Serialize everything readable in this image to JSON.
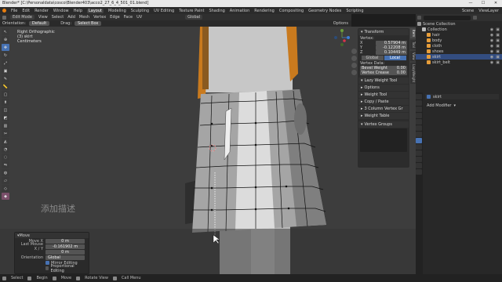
{
  "titlebar": {
    "title": "Blender* [C:\\Personaldata\\cosco\\Blender403\\acco2_27_6_4_501_01.blend]",
    "buttons": [
      "—",
      "☐",
      "✕"
    ]
  },
  "menubar": {
    "menus": [
      "File",
      "Edit",
      "Render",
      "Window",
      "Help"
    ],
    "workspaces": [
      "Layout",
      "Modeling",
      "Sculpting",
      "UV Editing",
      "Texture Paint",
      "Shading",
      "Animation",
      "Rendering",
      "Compositing",
      "Geometry Nodes",
      "Scripting"
    ],
    "active_workspace": "Layout",
    "scene": "Scene",
    "view_layer": "ViewLayer"
  },
  "header": {
    "mode": "Edit Mode",
    "menus": [
      "View",
      "Select",
      "Add",
      "Mesh",
      "Vertex",
      "Edge",
      "Face",
      "UV"
    ],
    "transform_orientation": "Global"
  },
  "tool_header": {
    "orientation_label": "Orientation:",
    "orientation_value": "Default",
    "drag_label": "Drag:",
    "drag_value": "Select Box",
    "options_label": "Options"
  },
  "viewport_info": {
    "line1": "Right Orthographic",
    "line2": "(3) skirt",
    "line3": "Centimeters"
  },
  "overlay_label": "添加描述",
  "npanel": {
    "transform_title": "Transform",
    "vertex_label": "Vertex:",
    "x_label": "X",
    "x_value": "0.57904 m",
    "y_label": "Y",
    "y_value": "-0.12208 m",
    "z_label": "Z",
    "z_value": "0.10449 m",
    "global_label": "Global",
    "local_label": "Local",
    "vertex_data_label": "Vertex Data:",
    "bevel_weight_label": "Bevel Weight",
    "bevel_weight_value": "0.00",
    "vertex_crease_label": "Vertex Crease",
    "vertex_crease_value": "0.00",
    "lazy_weight_title": "Lazy Weight Tool",
    "lazy_options": "Options",
    "weight_tool_label": "Weight Tool",
    "copy_paste_label": "Copy / Paste",
    "column_vertex_label": "3 Column Vertex Gr",
    "weight_table_label": "Weight Table",
    "vertex_groups_title": "Vertex Groups"
  },
  "vtabs": [
    "Item",
    "Tool",
    "View",
    "LazyWeight"
  ],
  "outliner": {
    "title": "Scene Collection",
    "items": [
      {
        "name": "Collection",
        "indent": 1,
        "icon": "collection-icon",
        "selected": false
      },
      {
        "name": "hair",
        "indent": 2,
        "icon": "mesh-icon",
        "selected": false
      },
      {
        "name": "body",
        "indent": 2,
        "icon": "mesh-icon",
        "selected": false
      },
      {
        "name": "cloth",
        "indent": 2,
        "icon": "mesh-icon",
        "selected": false
      },
      {
        "name": "shoes",
        "indent": 2,
        "icon": "mesh-icon",
        "selected": false
      },
      {
        "name": "skirt",
        "indent": 2,
        "icon": "mesh-icon",
        "selected": true
      },
      {
        "name": "skirt_belt",
        "indent": 2,
        "icon": "mesh-icon",
        "selected": false
      }
    ]
  },
  "properties": {
    "object_name": "skirt",
    "add_modifier_label": "Add Modifier"
  },
  "adjust_panel": {
    "title": "Move",
    "move_label": "Move X",
    "move_x": "0 m",
    "move_y": "-0.161902 m",
    "move_z": "0 m",
    "orientation_label": "Orientation",
    "orientation_value": "Global",
    "mirror_label": "Mirror Editing",
    "proportional_label": "Proportional Editing",
    "last_op_label": "Last Mouse X / Y"
  },
  "statusbar": {
    "items": [
      "Select",
      "Begin",
      "Move",
      "Rotate View",
      "Call Menu"
    ]
  },
  "colors": {
    "accent": "#4772b3",
    "selected_row": "#334d80",
    "viewport_bg": "#3d3d3d",
    "mesh_skin": "#d6d6d6",
    "hair_orange": "#c97a1e"
  }
}
